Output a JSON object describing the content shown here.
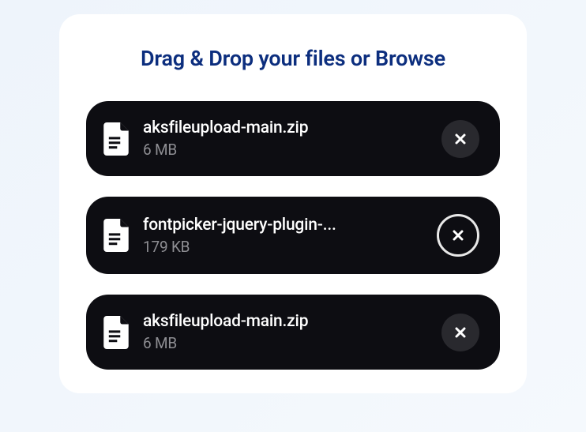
{
  "heading": "Drag & Drop your files or Browse",
  "files": [
    {
      "name": "aksfileupload-main.zip",
      "size": "6 MB",
      "remove_hover": false
    },
    {
      "name": "fontpicker-jquery-plugin-...",
      "size": "179 KB",
      "remove_hover": true
    },
    {
      "name": "aksfileupload-main.zip",
      "size": "6 MB",
      "remove_hover": false
    }
  ]
}
